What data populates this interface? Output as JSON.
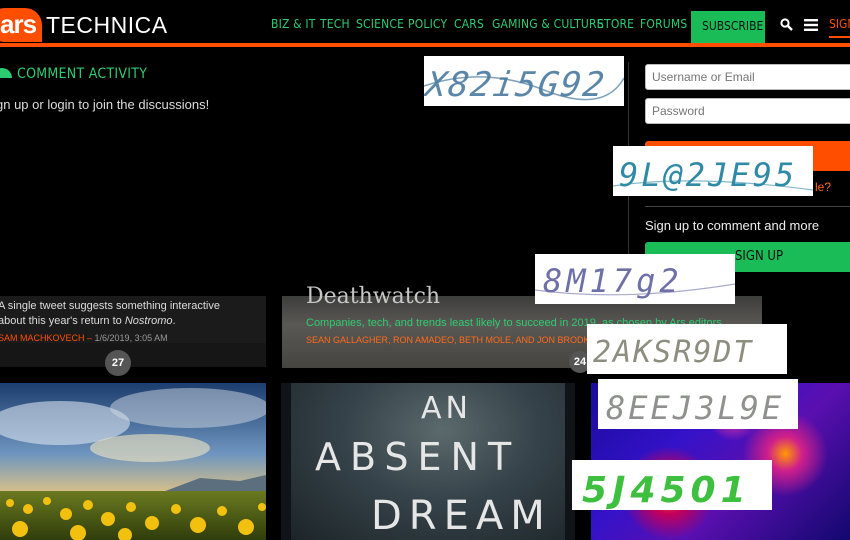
{
  "header": {
    "logo_ars": "ars",
    "logo_technica": "TECHNICA",
    "nav": [
      {
        "label": "BIZ & IT"
      },
      {
        "label": "TECH"
      },
      {
        "label": "SCIENCE"
      },
      {
        "label": "POLICY"
      },
      {
        "label": "CARS"
      },
      {
        "label": "GAMING & CULTURE"
      },
      {
        "label": "STORE"
      },
      {
        "label": "FORUMS"
      }
    ],
    "subscribe_label": "SUBSCRIBE",
    "sign_label": "SIGN",
    "accent_color": "#ff4e00",
    "green_color": "#2ecc71"
  },
  "comment_activity": {
    "title": "COMMENT ACTIVITY",
    "text": "gn up or login to join the discussions!"
  },
  "login": {
    "username_placeholder": "Username or Email",
    "password_placeholder": "Password",
    "trouble_fragment": "le?",
    "signup_prompt": "Sign up to comment and more",
    "signup_button": "SIGN UP"
  },
  "articles": [
    {
      "teaser": "A single tweet suggests something interactive about this year's return to ",
      "teaser_em": "Nostromo",
      "teaser_end": ".",
      "author": "SAM MACHKOVECH",
      "date": "1/6/2019, 3:05 AM",
      "comments": "27"
    },
    {
      "title": "Deathwatch",
      "subtitle": "Companies, tech, and trends least likely to succeed in 2019, as chosen by Ars editors",
      "authors": "SEAN GALLAGHER, RON AMADEO, BETH MOLE, AND JON BRODKIN",
      "comments": "24"
    }
  ],
  "book_cover": {
    "line1": "AN",
    "line2": "ABSENT",
    "line3": "DREAM"
  },
  "captchas": [
    {
      "text": "X82i5G92",
      "color": "#5a86a8"
    },
    {
      "text": "9L@2JE95",
      "color": "#2f8aa6"
    },
    {
      "text": "8M17g2",
      "color": "#6f70a8"
    },
    {
      "text": "2AKSR9DT",
      "color": "#8e8e80"
    },
    {
      "text": "8EEJ3L9E",
      "color": "#8e918e"
    },
    {
      "text": "5J4501",
      "color": "#3fbf3f"
    }
  ]
}
